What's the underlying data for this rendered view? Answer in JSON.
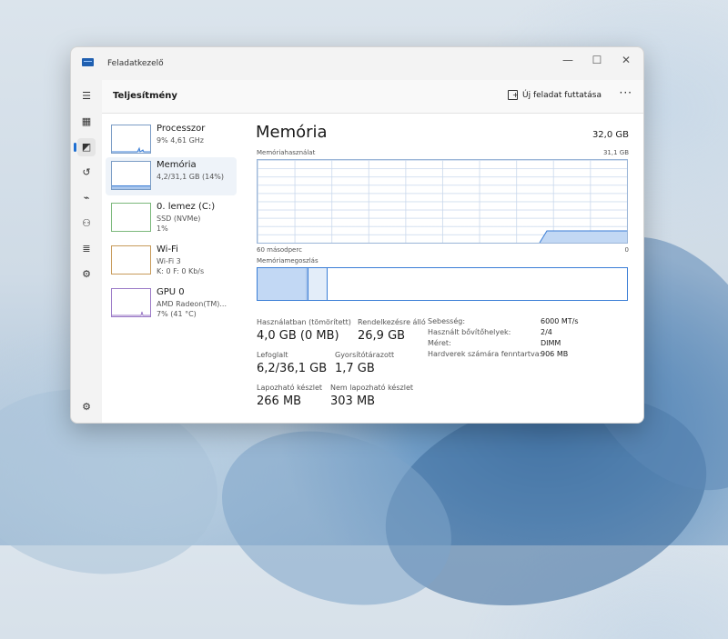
{
  "window": {
    "title": "Feladatkezelő",
    "controls": {
      "minimize": "—",
      "maximize": "☐",
      "close": "✕"
    }
  },
  "header": {
    "page_title": "Teljesítmény",
    "run_task_label": "Új feladat futtatása",
    "more_label": "···"
  },
  "rail": [
    {
      "icon": "hamburger-menu-icon",
      "glyph": "☰"
    },
    {
      "icon": "processes-icon",
      "glyph": "▦"
    },
    {
      "icon": "performance-icon",
      "glyph": "◩"
    },
    {
      "icon": "app-history-icon",
      "glyph": "↺"
    },
    {
      "icon": "startup-apps-icon",
      "glyph": "⌁"
    },
    {
      "icon": "users-icon",
      "glyph": "⚇"
    },
    {
      "icon": "details-icon",
      "glyph": "≣"
    },
    {
      "icon": "services-icon",
      "glyph": "⚙"
    },
    {
      "icon": "settings-icon",
      "glyph": "⚙"
    }
  ],
  "devices": [
    {
      "name": "Processzor",
      "sub1": "9% 4,61 GHz",
      "sub2": "",
      "usage_percent": 9
    },
    {
      "name": "Memória",
      "sub1": "4,2/31,1 GB (14%)",
      "sub2": "",
      "usage_percent": 14
    },
    {
      "name": "0. lemez (C:)",
      "sub1": "SSD (NVMe)",
      "sub2": "1%",
      "usage_percent": 1
    },
    {
      "name": "Wi-Fi",
      "sub1": "Wi-Fi 3",
      "sub2": "K: 0  F: 0 Kb/s",
      "usage_percent": 0
    },
    {
      "name": "GPU 0",
      "sub1": "AMD Radeon(TM)...",
      "sub2": "7% (41 °C)",
      "usage_percent": 7
    }
  ],
  "memory": {
    "title": "Memória",
    "total": "32,0 GB",
    "usage_label": "Memóriahasználat",
    "usage_max": "31,1 GB",
    "time_left": "60 másodperc",
    "time_right": "0",
    "composition_label": "Memóriamegoszlás",
    "stats": {
      "in_use_label": "Használatban (tömörített)",
      "in_use_value": "4,0 GB (0 MB)",
      "available_label": "Rendelkezésre álló",
      "available_value": "26,9 GB",
      "committed_label": "Lefoglalt",
      "committed_value": "6,2/36,1 GB",
      "cached_label": "Gyorsítótárazott",
      "cached_value": "1,7 GB",
      "paged_label": "Lapozható készlet",
      "paged_value": "266 MB",
      "nonpaged_label": "Nem lapozható készlet",
      "nonpaged_value": "303 MB"
    },
    "properties": [
      {
        "key": "Sebesség:",
        "value": "6000 MT/s"
      },
      {
        "key": "Használt bővítőhelyek:",
        "value": "2/4"
      },
      {
        "key": "Méret:",
        "value": "DIMM"
      },
      {
        "key": "Hardverek számára fenntartva:",
        "value": "906 MB"
      }
    ]
  },
  "colors": {
    "accent": "#3b7ed6",
    "graph_fill": "#a9c6ec",
    "selected_bg": "#eef3f9"
  }
}
